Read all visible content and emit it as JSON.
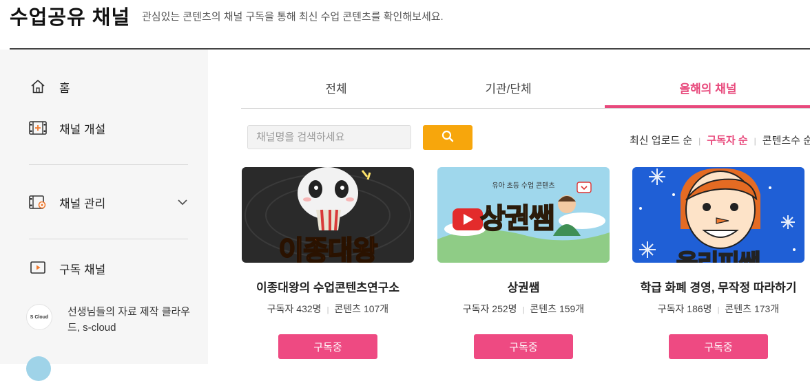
{
  "header": {
    "title": "수업공유 채널",
    "subtitle": "관심있는 콘텐츠의 채널 구독을 통해 최신 수업 콘텐츠를 확인해보세요."
  },
  "sidebar": {
    "items": [
      {
        "label": "홈",
        "icon": "home-icon"
      },
      {
        "label": "채널 개설",
        "icon": "film-add-icon"
      },
      {
        "label": "채널 관리",
        "icon": "film-gear-icon"
      },
      {
        "label": "구독 채널",
        "icon": "play-box-icon"
      }
    ],
    "subscribed": [
      {
        "name": "선생님들의 자료 제작 클라우드, s-cloud",
        "logo": "S Cloud"
      }
    ]
  },
  "tabs": [
    {
      "label": "전체",
      "active": false
    },
    {
      "label": "기관/단체",
      "active": false
    },
    {
      "label": "올해의 채널",
      "active": true
    }
  ],
  "search": {
    "placeholder": "채널명을 검색하세요",
    "value": ""
  },
  "sort": {
    "options": [
      "최신 업로드 순",
      "구독자 순",
      "콘텐츠수 순"
    ],
    "active": "구독자 순"
  },
  "cards": [
    {
      "name": "이종대왕의 수업콘텐츠연구소",
      "subscribers": "구독자 432명",
      "contents": "콘텐츠 107개",
      "button": "구독중",
      "thumb_text": "이종대왕"
    },
    {
      "name": "상권쌤",
      "subscribers": "구독자 252명",
      "contents": "콘텐츠 159개",
      "button": "구독중",
      "thumb_text": "상권쌤",
      "thumb_caption": "유아 초등 수업 콘텐츠"
    },
    {
      "name": "학급 화폐 경영, 무작정 따라하기",
      "subscribers": "구독자 186명",
      "contents": "콘텐츠 173개",
      "button": "구독중",
      "thumb_text": "올리피쌤"
    }
  ],
  "colors": {
    "accent": "#e8497c",
    "search_button": "#f7a60c",
    "subscribe_button": "#ee4a82"
  }
}
